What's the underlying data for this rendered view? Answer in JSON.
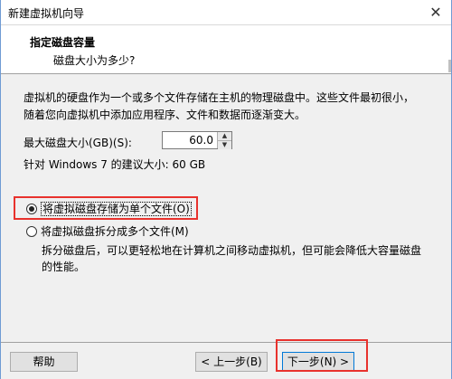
{
  "window": {
    "title": "新建虚拟机向导",
    "close_glyph": "✕"
  },
  "header": {
    "title": "指定磁盘容量",
    "subtitle": "磁盘大小为多少?"
  },
  "content": {
    "description": "虚拟机的硬盘作为一个或多个文件存储在主机的物理磁盘中。这些文件最初很小，随着您向虚拟机中添加应用程序、文件和数据而逐渐变大。",
    "max_size_label": "最大磁盘大小(GB)(S):",
    "max_size_value": "60.0",
    "recommendation": "针对 Windows 7 的建议大小: 60 GB",
    "option_single_label": "将虚拟磁盘存储为单个文件(O)",
    "option_split_label": "将虚拟磁盘拆分成多个文件(M)",
    "split_description": "拆分磁盘后，可以更轻松地在计算机之间移动虚拟机，但可能会降低大容量磁盘的性能。"
  },
  "footer": {
    "help_label": "帮助",
    "back_label": "< 上一步(B)",
    "next_label": "下一步(N) >"
  },
  "icons": {
    "spin_up": "▲",
    "spin_down": "▼"
  },
  "colors": {
    "highlight_box": "#e8322d",
    "default_button_border": "#0078d7"
  },
  "selection": {
    "selected_option": "option_single"
  }
}
